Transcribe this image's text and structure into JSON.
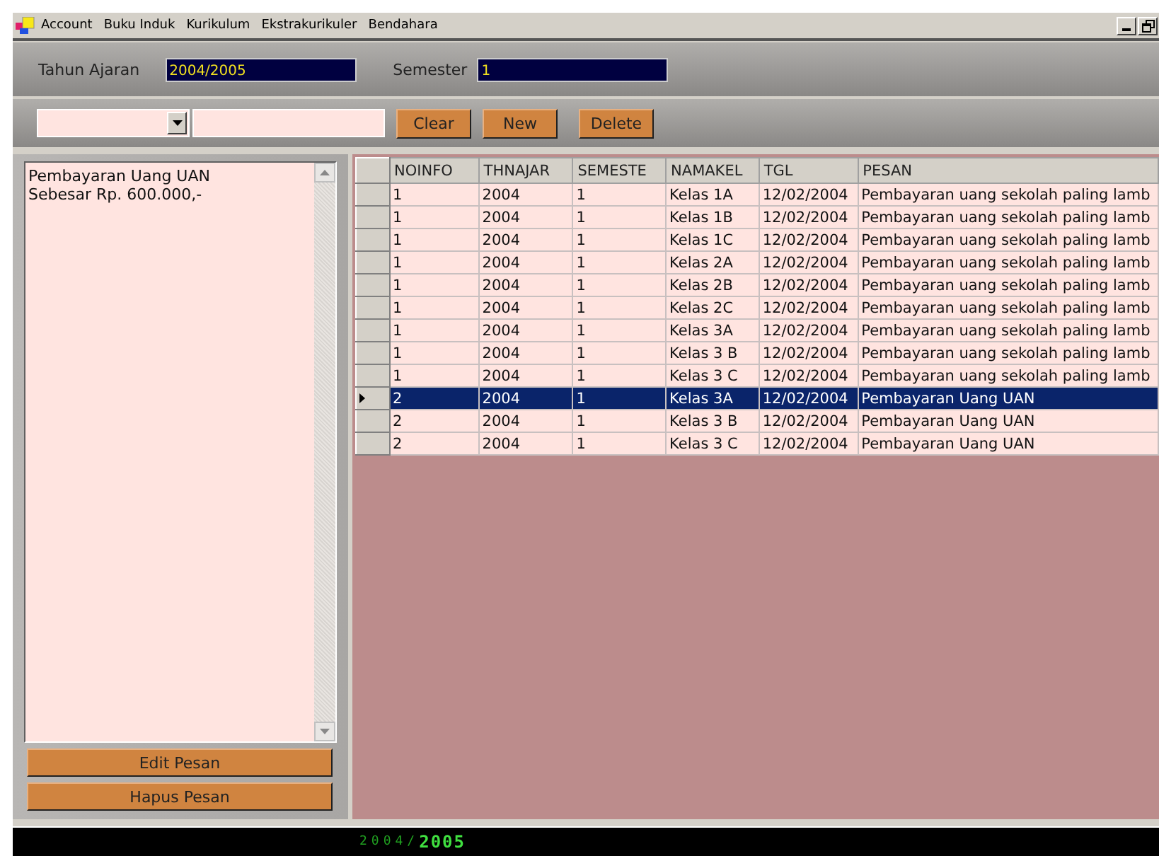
{
  "menu": [
    "Account",
    "Buku Induk",
    "Kurikulum",
    "Ekstrakurikuler",
    "Bendahara"
  ],
  "header": {
    "tahun_label": "Tahun Ajaran",
    "tahun_value": "2004/2005",
    "semester_label": "Semester",
    "semester_value": "1"
  },
  "toolbar": {
    "buttons": [
      "Clear",
      "New",
      "Delete"
    ]
  },
  "message": {
    "lines": [
      "Pembayaran Uang UAN",
      "Sebesar Rp. 600.000,-"
    ],
    "buttons": [
      "Edit Pesan",
      "Hapus Pesan"
    ]
  },
  "table": {
    "columns": [
      "NOINFO",
      "THNAJAR",
      "SEMESTE",
      "NAMAKEL",
      "TGL",
      "PESAN"
    ],
    "rows": [
      {
        "selected": false,
        "cells": [
          "1",
          "2004",
          "1",
          "Kelas 1A",
          "12/02/2004",
          "Pembayaran uang sekolah paling lamb"
        ]
      },
      {
        "selected": false,
        "cells": [
          "1",
          "2004",
          "1",
          "Kelas 1B",
          "12/02/2004",
          "Pembayaran uang sekolah paling lamb"
        ]
      },
      {
        "selected": false,
        "cells": [
          "1",
          "2004",
          "1",
          "Kelas 1C",
          "12/02/2004",
          "Pembayaran uang sekolah paling lamb"
        ]
      },
      {
        "selected": false,
        "cells": [
          "1",
          "2004",
          "1",
          "Kelas 2A",
          "12/02/2004",
          "Pembayaran uang sekolah paling lamb"
        ]
      },
      {
        "selected": false,
        "cells": [
          "1",
          "2004",
          "1",
          "Kelas 2B",
          "12/02/2004",
          "Pembayaran uang sekolah paling lamb"
        ]
      },
      {
        "selected": false,
        "cells": [
          "1",
          "2004",
          "1",
          "Kelas 2C",
          "12/02/2004",
          "Pembayaran uang sekolah paling lamb"
        ]
      },
      {
        "selected": false,
        "cells": [
          "1",
          "2004",
          "1",
          "Kelas 3A",
          "12/02/2004",
          "Pembayaran uang sekolah paling lamb"
        ]
      },
      {
        "selected": false,
        "cells": [
          "1",
          "2004",
          "1",
          "Kelas 3 B",
          "12/02/2004",
          "Pembayaran uang sekolah paling lamb"
        ]
      },
      {
        "selected": false,
        "cells": [
          "1",
          "2004",
          "1",
          "Kelas 3 C",
          "12/02/2004",
          "Pembayaran uang sekolah paling lamb"
        ]
      },
      {
        "selected": true,
        "cells": [
          "2",
          "2004",
          "1",
          "Kelas 3A",
          "12/02/2004",
          "Pembayaran Uang UAN"
        ]
      },
      {
        "selected": false,
        "cells": [
          "2",
          "2004",
          "1",
          "Kelas 3 B",
          "12/02/2004",
          "Pembayaran Uang UAN"
        ]
      },
      {
        "selected": false,
        "cells": [
          "2",
          "2004",
          "1",
          "Kelas 3 C",
          "12/02/2004",
          "Pembayaran Uang UAN"
        ]
      }
    ]
  },
  "status_bar": {
    "dim": "2004/",
    "bright": "2005"
  }
}
